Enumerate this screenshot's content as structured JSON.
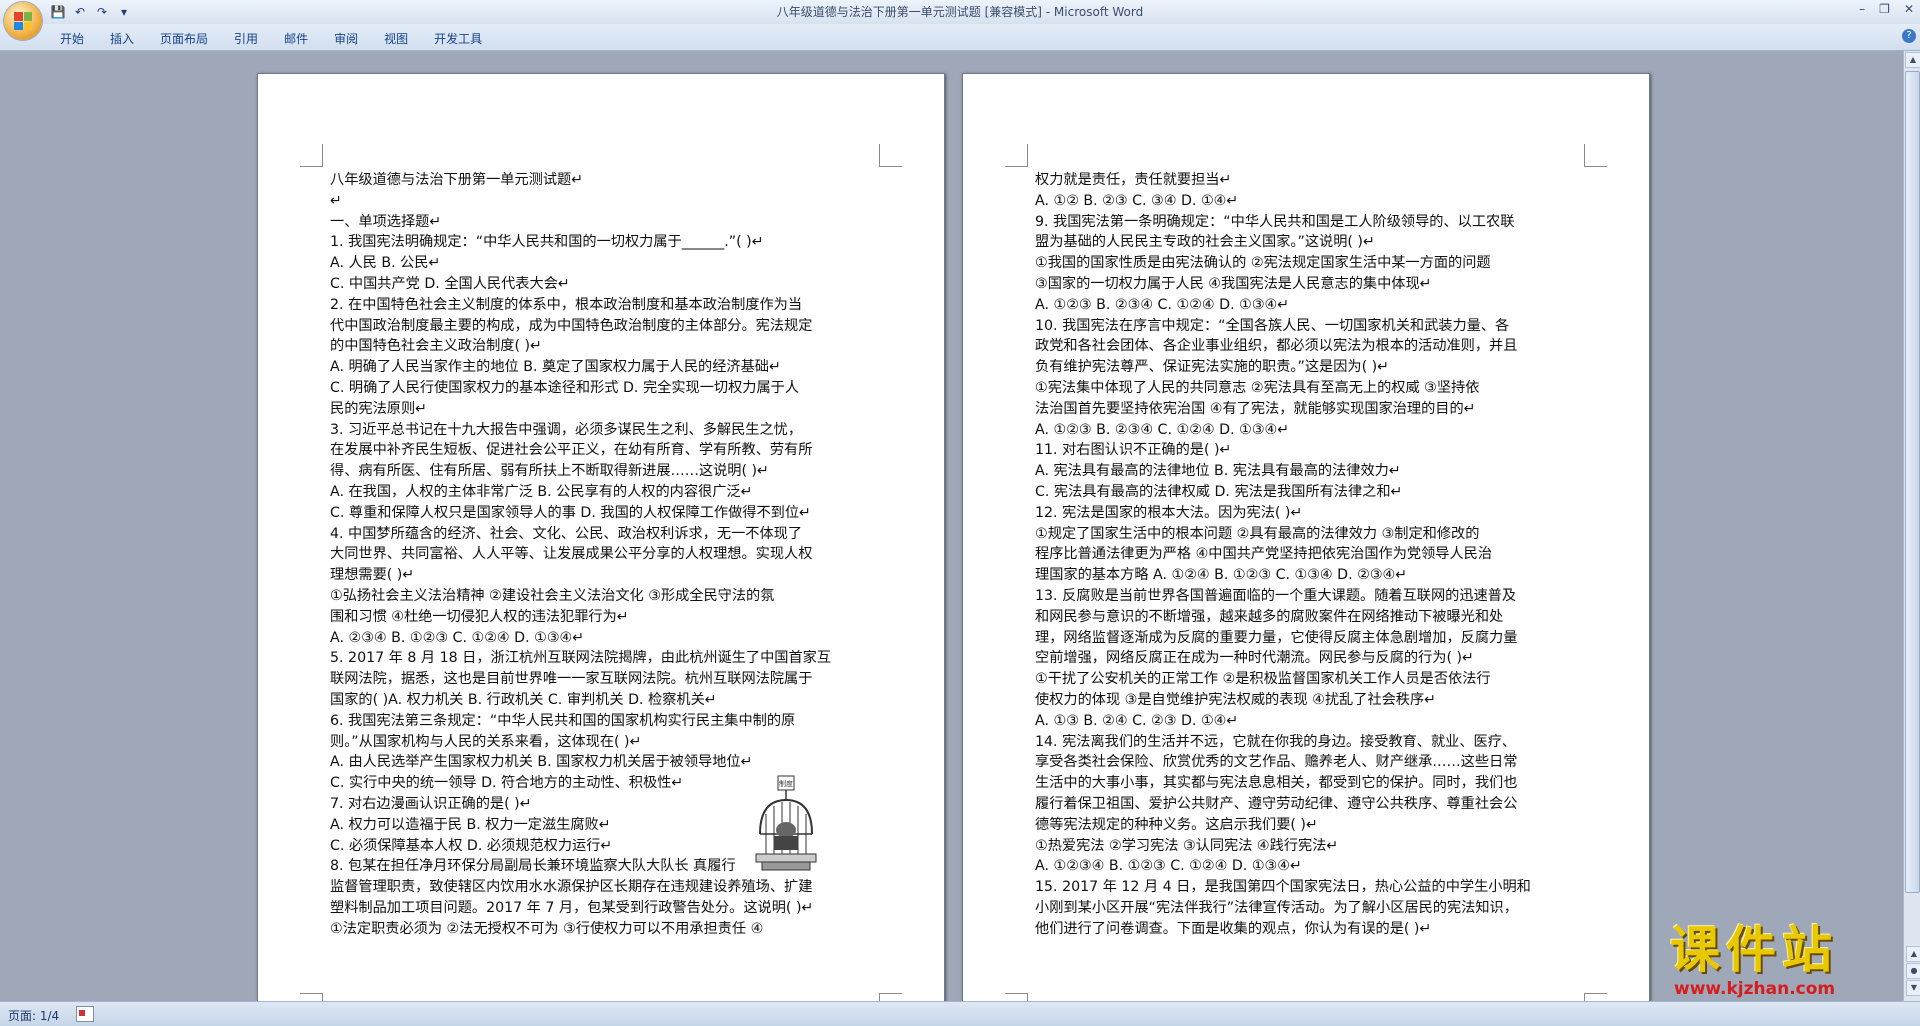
{
  "window": {
    "title": "八年级道德与法治下册第一单元测试题 [兼容模式] - Microsoft Word",
    "controls": [
      "–",
      "❐",
      "✕"
    ]
  },
  "quick_access": {
    "save_icon": "💾",
    "undo_icon": "↶",
    "redo_icon": "↷",
    "customize_icon": "▾"
  },
  "ribbon": {
    "tabs": [
      "开始",
      "插入",
      "页面布局",
      "引用",
      "邮件",
      "审阅",
      "视图",
      "开发工具"
    ],
    "help": "?"
  },
  "pages": [
    {
      "lines": [
        "八年级道德与法治下册第一单元测试题↵",
        "↵",
        "     一、单项选择题↵",
        "1.  我国宪法明确规定：“中华人民共和国的一切权力属于______.”(       )↵",
        "A.  人民                               B.  公民↵",
        "C.  中国共产党                         D.  全国人民代表大会↵",
        "2.  在中国特色社会主义制度的体系中，根本政治制度和基本政治制度作为当",
        "代中国政治制度最主要的构成，成为中国特色政治制度的主体部分。宪法规定",
        "的中国特色社会主义政治制度(       )↵",
        "A.  明确了人民当家作主的地位    B.  奠定了国家权力属于人民的经济基础↵",
        "C.  明确了人民行使国家权力的基本途径和形式    D.  完全实现一切权力属于人",
        "民的宪法原则↵",
        "3.  习近平总书记在十九大报告中强调，必须多谋民生之利、多解民生之忧，",
        "在发展中补齐民生短板、促进社会公平正义，在幼有所育、学有所教、劳有所",
        "得、病有所医、住有所居、弱有所扶上不断取得新进展……这说明(       )↵",
        "A.  在我国，人权的主体非常广泛    B.  公民享有的人权的内容很广泛↵",
        "C.  尊重和保障人权只是国家领导人的事    D.  我国的人权保障工作做得不到位↵",
        "4.  中国梦所蕴含的经济、社会、文化、公民、政治权利诉求，无一不体现了",
        "大同世界、共同富裕、人人平等、让发展成果公平分享的人权理想。实现人权",
        "理想需要(       )↵",
        "①弘扬社会主义法治精神    ②建设社会主义法治文化    ③形成全民守法的氛",
        "围和习惯    ④杜绝一切侵犯人权的违法犯罪行为↵",
        "A.  ②③④    B.  ①②③    C.  ①②④    D.  ①③④↵",
        "5.  2017 年 8 月 18 日，浙江杭州互联网法院揭牌，由此杭州诞生了中国首家互",
        "联网法院，据悉，这也是目前世界唯一一家互联网法院。杭州互联网法院属于",
        "国家的(       )A.  权力机关    B.  行政机关    C.  审判机关    D.  检察机关↵",
        "6.  我国宪法第三条规定：“中华人民共和国的国家机构实行民主集中制的原",
        "则。”从国家机构与人民的关系来看，这体现在(       )↵",
        "A.  由人民选举产生国家权力机关 B.  国家权力机关居于被领导地位↵",
        "C.  实行中央的统一领导 D.  符合地方的主动性、积极性↵",
        "7.  对右边漫画认识正确的是(       )↵",
        "A.  权力可以造福于民 B.  权力一定滋生腐败↵",
        "C.  必须保障基本人权 D.  必须规范权力运行↵",
        "8.  包某在担任净月环保分局副局长兼环境监察大队大队长                    真履行",
        "监督管理职责，致使辖区内饮用水水源保护区长期存在违规建设养殖场、扩建",
        "塑料制品加工项目问题。2017 年 7 月，包某受到行政警告处分。这说明(       )↵",
        "①法定职责必须为    ②法无授权不可为    ③行使权力可以不用承担责任    ④"
      ]
    },
    {
      "lines": [
        "权力就是责任，责任就要担当↵",
        "A.  ①②    B.  ②③    C.  ③④    D.  ①④↵",
        "9.  我国宪法第一条明确规定：“中华人民共和国是工人阶级领导的、以工农联",
        "盟为基础的人民民主专政的社会主义国家。”这说明(       )↵",
        "①我国的国家性质是由宪法确认的    ②宪法规定国家生活中某一方面的问题",
        "③国家的一切权力属于人民    ④我国宪法是人民意志的集中体现↵",
        "A.  ①②③    B.  ②③④    C.  ①②④    D.  ①③④↵",
        "10.  我国宪法在序言中规定：“全国各族人民、一切国家机关和武装力量、各",
        "政党和各社会团体、各企业事业组织，都必须以宪法为根本的活动准则，并且",
        "负有维护宪法尊严、保证宪法实施的职责。”这是因为(       )↵",
        "①宪法集中体现了人民的共同意志    ②宪法具有至高无上的权威    ③坚持依",
        "法治国首先要坚持依宪治国    ④有了宪法，就能够实现国家治理的目的↵",
        "A.  ①②③    B.  ②③④    C.  ①②④    D.  ①③④↵",
        "11.  对右图认识不正确的是(       )↵",
        "A.  宪法具有最高的法律地位 B.  宪法具有最高的法律效力↵",
        "C.  宪法具有最高的法律权威 D.  宪法是我国所有法律之和↵",
        "12.  宪法是国家的根本大法。因为宪法(       )↵",
        "①规定了国家生活中的根本问题    ②具有最高的法律效力    ③制定和修改的",
        "程序比普通法律更为严格    ④中国共产党坚持把依宪治国作为党领导人民治",
        "理国家的基本方略 A.  ①②④    B.  ①②③    C.  ①③④    D.  ②③④↵",
        "13.  反腐败是当前世界各国普遍面临的一个重大课题。随着互联网的迅速普及",
        "和网民参与意识的不断增强，越来越多的腐败案件在网络推动下被曝光和处",
        "理，网络监督逐渐成为反腐的重要力量，它使得反腐主体急剧增加，反腐力量",
        "空前增强，网络反腐正在成为一种时代潮流。网民参与反腐的行为(       )↵",
        "①干扰了公安机关的正常工作    ②是积极监督国家机关工作人员是否依法行",
        "使权力的体现    ③是自觉维护宪法权威的表现    ④扰乱了社会秩序↵",
        "A.  ①③    B.  ②④    C.  ②③    D.  ①④↵",
        "14.  宪法离我们的生活并不远，它就在你我的身边。接受教育、就业、医疗、",
        "享受各类社会保险、欣赏优秀的文艺作品、赡养老人、财产继承……这些日常",
        "生活中的大事小事，其实都与宪法息息相关，都受到它的保护。同时，我们也",
        "履行着保卫祖国、爱护公共财产、遵守劳动纪律、遵守公共秩序、尊重社会公",
        "德等宪法规定的种种义务。这启示我们要(       )↵",
        "①热爱宪法    ②学习宪法    ③认同宪法    ④践行宪法↵",
        "A.  ①②③④    B.  ①②③    C.  ①②④    D.  ①③④↵",
        "15.  2017 年 12 月 4 日，是我国第四个国家宪法日，热心公益的中学生小明和",
        "小刚到某小区开展“宪法伴我行”法律宣传活动。为了解小区居民的宪法知识，",
        "他们进行了问卷调查。下面是收集的观点，你认为有误的是(       )↵"
      ]
    }
  ],
  "cartoon_label": "制度",
  "status": {
    "page": "页面: 1/4"
  },
  "watermark": {
    "title": "课件站",
    "url": "www.kjzhan.com"
  }
}
